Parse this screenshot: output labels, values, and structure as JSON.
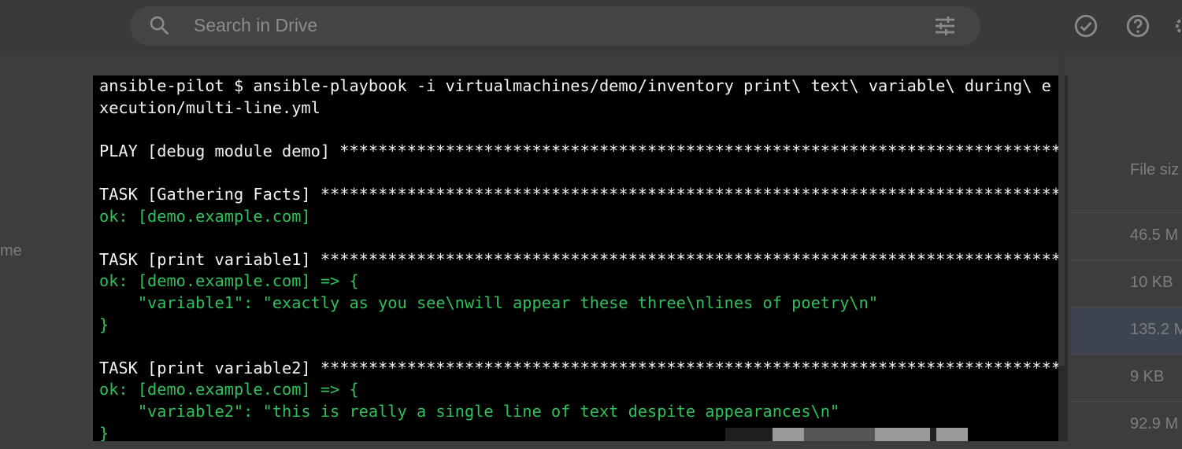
{
  "drive": {
    "search_placeholder": "Search in Drive",
    "left_fragment": "me",
    "file_size_header": "File siz",
    "file_sizes": [
      "46.5 M",
      "10 KB",
      "135.2 M",
      "9 KB",
      "92.9 M"
    ],
    "icons": [
      "search-icon",
      "tune-icon",
      "ready-for-offline-icon",
      "help-icon",
      "settings-icon"
    ]
  },
  "terminal": {
    "lines": [
      {
        "text": "ansible-pilot $ ansible-playbook -i virtualmachines/demo/inventory print\\ text\\ variable\\ during\\ e",
        "color": "white"
      },
      {
        "text": "xecution/multi-line.yml",
        "color": "white"
      },
      {
        "text": "",
        "color": "white"
      },
      {
        "text": "PLAY [debug module demo] ****************************************************************************",
        "color": "white"
      },
      {
        "text": "",
        "color": "white"
      },
      {
        "text": "TASK [Gathering Facts] ******************************************************************************",
        "color": "white"
      },
      {
        "text": "ok: [demo.example.com]",
        "color": "green"
      },
      {
        "text": "",
        "color": "white"
      },
      {
        "text": "TASK [print variable1] ******************************************************************************",
        "color": "white"
      },
      {
        "text": "ok: [demo.example.com] => {",
        "color": "green"
      },
      {
        "text": "    \"variable1\": \"exactly as you see\\nwill appear these three\\nlines of poetry\\n\"",
        "color": "green"
      },
      {
        "text": "}",
        "color": "green"
      },
      {
        "text": "",
        "color": "white"
      },
      {
        "text": "TASK [print variable2] ******************************************************************************",
        "color": "white"
      },
      {
        "text": "ok: [demo.example.com] => {",
        "color": "green"
      },
      {
        "text": "    \"variable2\": \"this is really a single line of text despite appearances\\n\"",
        "color": "green"
      },
      {
        "text": "}",
        "color": "green"
      }
    ]
  },
  "colors": {
    "terminal_bg": "#000000",
    "terminal_text": "#f2f2f2",
    "terminal_ok": "#2fc05a"
  }
}
